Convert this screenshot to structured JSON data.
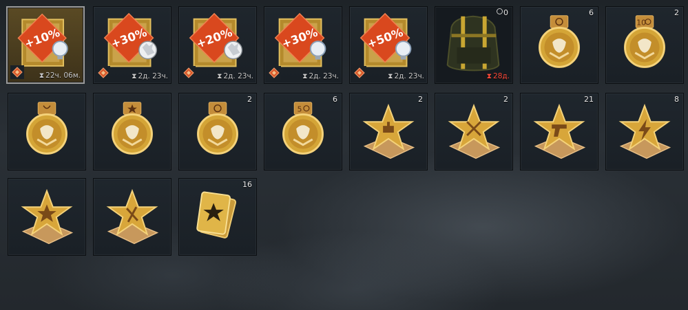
{
  "items": [
    {
      "kind": "booster",
      "label": "+10%",
      "badge": "bulb-icon",
      "timer": "22ч. 06м.",
      "selected": true
    },
    {
      "kind": "booster",
      "label": "+30%",
      "badge": "lion-icon",
      "timer": "2д. 23ч."
    },
    {
      "kind": "booster",
      "label": "+20%",
      "badge": "lion-icon",
      "timer": "2д. 23ч."
    },
    {
      "kind": "booster",
      "label": "+30%",
      "badge": "bulb-icon",
      "timer": "2д. 23ч."
    },
    {
      "kind": "booster",
      "label": "+50%",
      "badge": "bulb-icon",
      "timer": "2д. 23ч."
    },
    {
      "kind": "backpack",
      "count": "0",
      "timer": "28д."
    },
    {
      "kind": "medal",
      "top": "crosshair",
      "count": "6"
    },
    {
      "kind": "medal",
      "top": "10",
      "count": "2"
    },
    {
      "kind": "medal",
      "top": "laurel",
      "count": ""
    },
    {
      "kind": "medal",
      "top": "star",
      "count": ""
    },
    {
      "kind": "medal",
      "top": "crosshair",
      "count": "2"
    },
    {
      "kind": "medal",
      "top": "5",
      "count": "6"
    },
    {
      "kind": "star",
      "emblem": "tank",
      "count": "2"
    },
    {
      "kind": "star",
      "emblem": "crossed-swords",
      "count": "2"
    },
    {
      "kind": "star",
      "emblem": "pistol",
      "count": "21"
    },
    {
      "kind": "star",
      "emblem": "lightning",
      "count": "8"
    },
    {
      "kind": "star",
      "emblem": "star",
      "count": ""
    },
    {
      "kind": "star",
      "emblem": "cross",
      "count": ""
    },
    {
      "kind": "cards",
      "count": "16"
    }
  ]
}
